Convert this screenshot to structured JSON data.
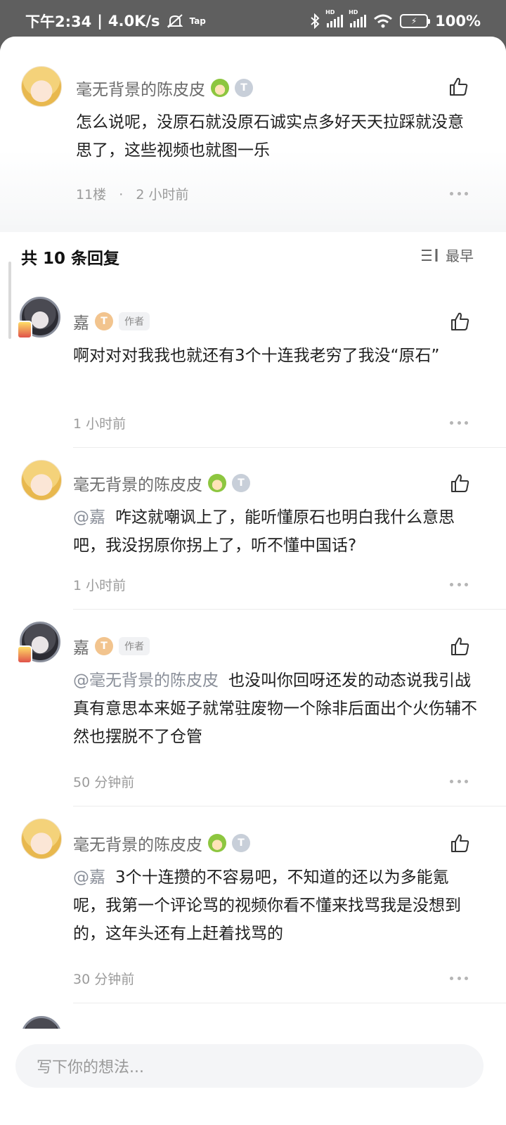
{
  "status_bar": {
    "time": "下午2:34",
    "speed": "4.0K/s",
    "tap_label": "Tap",
    "battery": "100%"
  },
  "main_comment": {
    "author": "毫无背景的陈皮皮",
    "text": "怎么说呢，没原石就没原石诚实点多好天天拉踩就没意思了，这些视频也就图一乐",
    "floor": "11楼",
    "time": "2 小时前"
  },
  "replies_header": {
    "title": "共 10 条回复",
    "sort_label": "最早"
  },
  "replies": [
    {
      "author": "嘉",
      "author_tag": "作者",
      "mention": "",
      "text": "啊对对对我我也就还有3个十连我老穷了我没“原石”",
      "time": "1 小时前"
    },
    {
      "author": "毫无背景的陈皮皮",
      "author_tag": "",
      "mention": "@嘉",
      "text": "咋这就嘲讽上了，能听懂原石也明白我什么意思吧，我没拐原你拐上了，听不懂中国话?",
      "time": "1 小时前"
    },
    {
      "author": "嘉",
      "author_tag": "作者",
      "mention": "@毫无背景的陈皮皮",
      "text": "也没叫你回呀还发的动态说我引战真有意思本来姬子就常驻废物一个除非后面出个火伤辅不然也摆脱不了仓管",
      "time": "50 分钟前"
    },
    {
      "author": "毫无背景的陈皮皮",
      "author_tag": "",
      "mention": "@嘉",
      "text": "3个十连攒的不容易吧，不知道的还以为多能氪呢，我第一个评论骂的视频你看不懂来找骂我是没想到的，这年头还有上赶着找骂的",
      "time": "30 分钟前"
    }
  ],
  "composer": {
    "placeholder": "写下你的想法..."
  },
  "colors": {
    "status_bar_bg": "#5f5f5f",
    "mention": "#8a8f99",
    "meta": "#9b9b9b"
  }
}
